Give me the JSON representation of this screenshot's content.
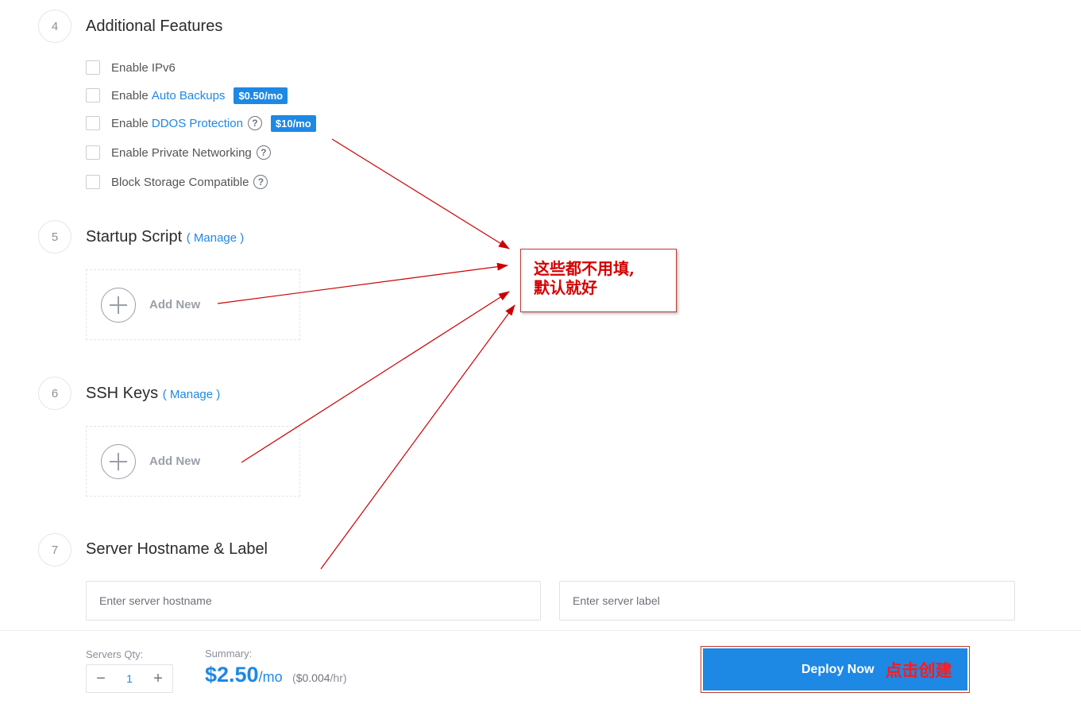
{
  "sections": {
    "additional_features": {
      "number": "4",
      "title": "Additional Features"
    },
    "startup_script": {
      "number": "5",
      "title": "Startup Script",
      "manage_open": "( ",
      "manage_label": "Manage",
      "manage_close": " )",
      "add_label": "Add New"
    },
    "ssh_keys": {
      "number": "6",
      "title": "SSH Keys",
      "manage_open": "( ",
      "manage_label": "Manage",
      "manage_close": " )",
      "add_label": "Add New"
    },
    "hostname": {
      "number": "7",
      "title": "Server Hostname & Label",
      "hostname_placeholder": "Enter server hostname",
      "label_placeholder": "Enter server label"
    }
  },
  "options": {
    "ipv6": {
      "label": "Enable IPv6"
    },
    "backups": {
      "prefix": "Enable ",
      "link": "Auto Backups",
      "badge": "$0.50/mo"
    },
    "ddos": {
      "prefix": "Enable ",
      "link": "DDOS Protection",
      "help": "?",
      "badge": "$10/mo"
    },
    "private_net": {
      "label": "Enable Private Networking",
      "help": "?"
    },
    "block_storage": {
      "label": "Block Storage Compatible",
      "help": "?"
    }
  },
  "footer": {
    "qty_label": "Servers Qty:",
    "qty_value": "1",
    "minus": "−",
    "plus": "+",
    "summary_label": "Summary:",
    "price": "$2.50",
    "price_unit": "/mo",
    "hourly_prefix": "(",
    "hourly": "$0.004",
    "hourly_unit": "/hr)",
    "deploy_label": "Deploy Now"
  },
  "annotations": {
    "note_line1": "这些都不用填,",
    "note_line2": "默认就好",
    "deploy_note": "点击创建"
  },
  "colors": {
    "accent": "#1e88e5",
    "annotation": "#d40000"
  }
}
